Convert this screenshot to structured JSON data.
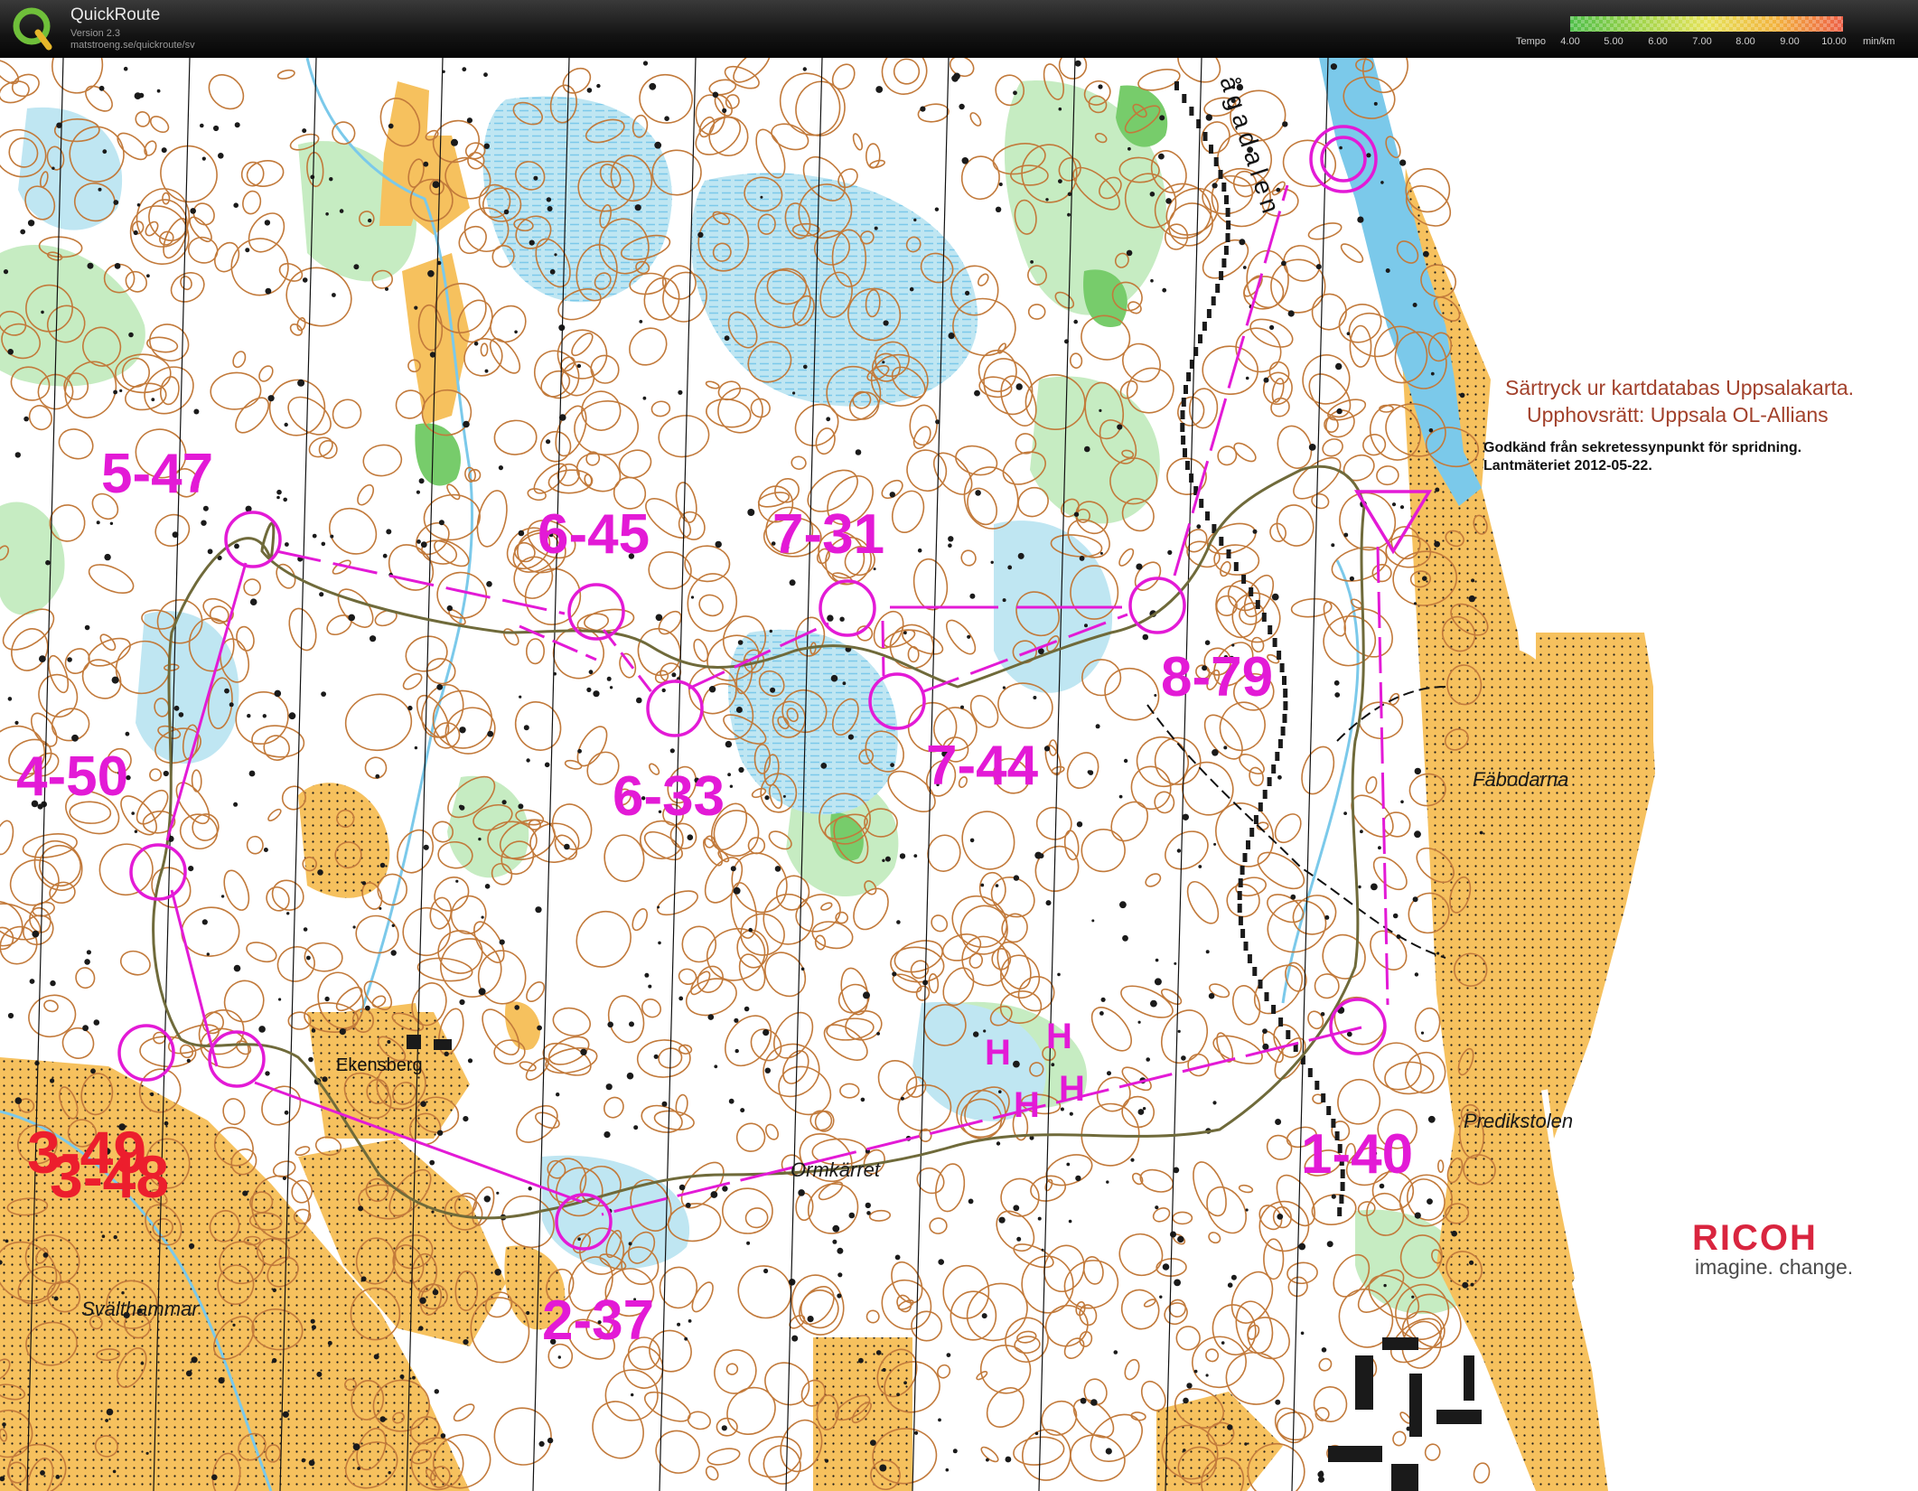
{
  "app": {
    "title": "QuickRoute",
    "version": "Version 2.3",
    "url": "matstroeng.se/quickroute/sv"
  },
  "tempo_legend": {
    "label": "Tempo",
    "ticks": [
      "4.00",
      "5.00",
      "6.00",
      "7.00",
      "8.00",
      "9.00",
      "10.00"
    ],
    "unit": "min/km",
    "colors": [
      "#4fbf4a",
      "#9fd44a",
      "#e6e35a",
      "#f2b43e",
      "#ee5f46"
    ]
  },
  "map": {
    "colors": {
      "forest": "#ffffff",
      "light_green": "#c6ecc2",
      "green": "#77cc6b",
      "open": "#f6c15e",
      "marsh_blue": "#bfe6f2",
      "water": "#7bc9ea",
      "contour": "#c27a3b",
      "rock": "#1a1a1a",
      "course": "#e31ad6",
      "route": "#6f6a3a"
    },
    "copyright_line1": "Särtryck ur kartdatabas Uppsalakarta.",
    "copyright_line2": "Upphovsrätt: Uppsala OL-Allians",
    "approval_line1": "Godkänd från sekretessynpunkt för spridning.",
    "approval_line2": "Lantmäteriet 2012-05-22.",
    "sponsor_name": "RICOH",
    "sponsor_tagline": "imagine. change.",
    "places": {
      "fabodarna": "Fäbodarna",
      "predikstolen": "Predikstolen",
      "ormkarret": "Ormkärret",
      "ekensberg": "Ekensberg",
      "svalthammar": "Svälthammar",
      "agadalen": "ågadalen"
    },
    "controls": {
      "c1": "1-40",
      "c2": "2-37",
      "c3a": "3-49",
      "c3b": "3-48",
      "c4": "4-50",
      "c5": "5-47",
      "c6a": "6-45",
      "c6b": "6-33",
      "c7a": "7-31",
      "c7b": "7-44",
      "c8": "8-79"
    },
    "h_mark": "H"
  }
}
